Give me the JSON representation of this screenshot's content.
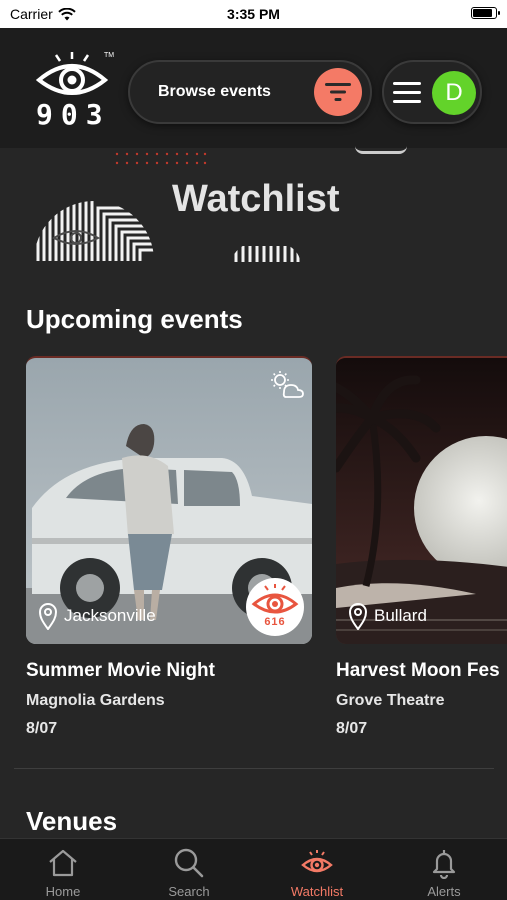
{
  "status_bar": {
    "carrier": "Carrier",
    "time": "3:35 PM",
    "battery_level": 0.92
  },
  "header": {
    "logo_text": "903",
    "logo_tm": "TM",
    "browse_label": "Browse events",
    "avatar_initial": "D",
    "colors": {
      "accent": "#f47a66",
      "avatar": "#63d32a"
    }
  },
  "page": {
    "title": "Watchlist"
  },
  "upcoming": {
    "title": "Upcoming events",
    "events": [
      {
        "city": "Jacksonville",
        "name": "Summer Movie Night",
        "venue": "Magnolia Gardens",
        "date": "8/07",
        "watch_count": "616"
      },
      {
        "city": "Bullard",
        "name": "Harvest Moon Fes",
        "venue": "Grove Theatre",
        "date": "8/07"
      }
    ]
  },
  "venues": {
    "title": "Venues"
  },
  "tabs": [
    {
      "label": "Home",
      "icon": "home-icon"
    },
    {
      "label": "Search",
      "icon": "search-icon"
    },
    {
      "label": "Watchlist",
      "icon": "eye-icon",
      "active": true
    },
    {
      "label": "Alerts",
      "icon": "bell-icon"
    }
  ]
}
